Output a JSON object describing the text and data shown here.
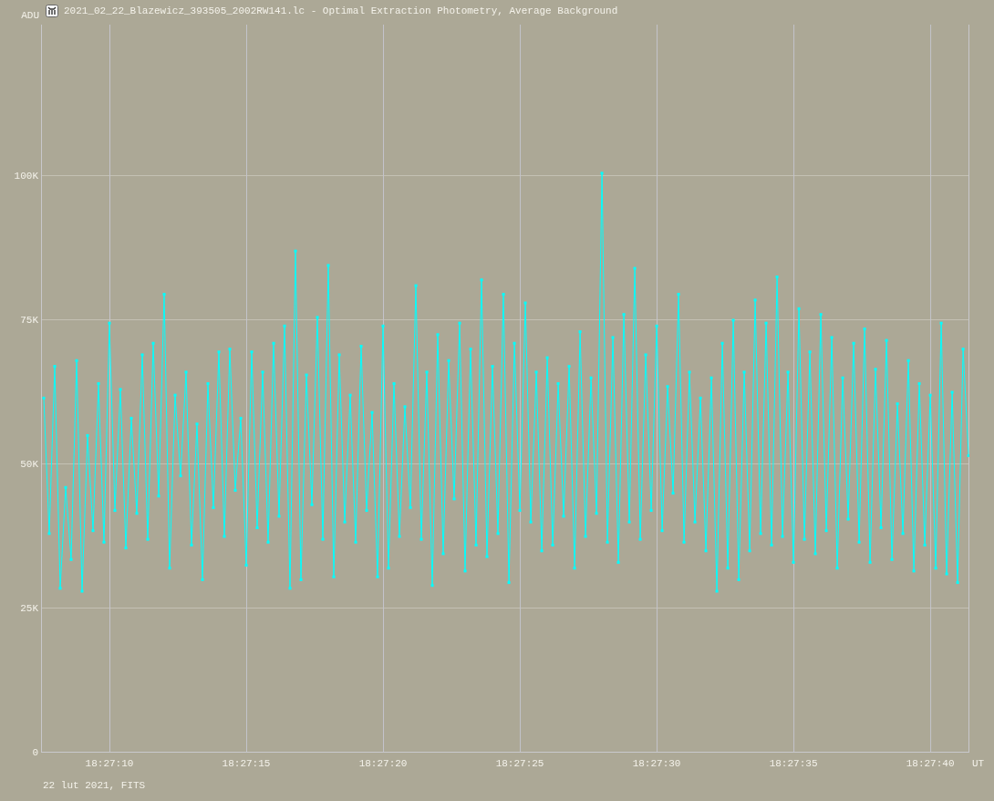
{
  "window": {
    "title": "2021_02_22_Blazewicz_393505_2002RW141.lc - Optimal Extraction Photometry, Average Background"
  },
  "chart_data": {
    "type": "line",
    "ylabel": "ADU",
    "xlabel": "UT",
    "grid": true,
    "xlim": [
      66427.5,
      66461.43
    ],
    "ylim": [
      0,
      126266
    ],
    "xticks": [
      {
        "value": 66430,
        "label": "18:27:10"
      },
      {
        "value": 66435,
        "label": "18:27:15"
      },
      {
        "value": 66440,
        "label": "18:27:20"
      },
      {
        "value": 66445,
        "label": "18:27:25"
      },
      {
        "value": 66450,
        "label": "18:27:30"
      },
      {
        "value": 66455,
        "label": "18:27:35"
      },
      {
        "value": 66460,
        "label": "18:27:40"
      }
    ],
    "yticks": [
      {
        "value": 100000,
        "label": "100K"
      },
      {
        "value": 75000,
        "label": "75K"
      },
      {
        "value": 50000,
        "label": "50K"
      },
      {
        "value": 25000,
        "label": "25K"
      },
      {
        "value": 0,
        "label": "0"
      }
    ],
    "x": [
      66427.6,
      66427.8,
      66428.0,
      66428.2,
      66428.4,
      66428.6,
      66428.8,
      66429.0,
      66429.2,
      66429.4,
      66429.6,
      66429.8,
      66430.0,
      66430.2,
      66430.4,
      66430.6,
      66430.8,
      66431.0,
      66431.2,
      66431.4,
      66431.6,
      66431.8,
      66432.0,
      66432.2,
      66432.4,
      66432.6,
      66432.8,
      66433.0,
      66433.2,
      66433.4,
      66433.6,
      66433.8,
      66434.0,
      66434.2,
      66434.4,
      66434.6,
      66434.8,
      66435.0,
      66435.2,
      66435.4,
      66435.6,
      66435.8,
      66436.0,
      66436.2,
      66436.4,
      66436.6,
      66436.8,
      66437.0,
      66437.2,
      66437.4,
      66437.6,
      66437.8,
      66438.0,
      66438.2,
      66438.4,
      66438.6,
      66438.8,
      66439.0,
      66439.2,
      66439.4,
      66439.6,
      66439.8,
      66440.0,
      66440.2,
      66440.4,
      66440.6,
      66440.8,
      66441.0,
      66441.2,
      66441.4,
      66441.6,
      66441.8,
      66442.0,
      66442.2,
      66442.4,
      66442.6,
      66442.8,
      66443.0,
      66443.2,
      66443.4,
      66443.6,
      66443.8,
      66444.0,
      66444.2,
      66444.4,
      66444.6,
      66444.8,
      66445.0,
      66445.2,
      66445.4,
      66445.6,
      66445.8,
      66446.0,
      66446.2,
      66446.4,
      66446.6,
      66446.8,
      66447.0,
      66447.2,
      66447.4,
      66447.6,
      66447.8,
      66448.0,
      66448.2,
      66448.4,
      66448.6,
      66448.8,
      66449.0,
      66449.2,
      66449.4,
      66449.6,
      66449.8,
      66450.0,
      66450.2,
      66450.4,
      66450.6,
      66450.8,
      66451.0,
      66451.2,
      66451.4,
      66451.6,
      66451.8,
      66452.0,
      66452.2,
      66452.4,
      66452.6,
      66452.8,
      66453.0,
      66453.2,
      66453.4,
      66453.6,
      66453.8,
      66454.0,
      66454.2,
      66454.4,
      66454.6,
      66454.8,
      66455.0,
      66455.2,
      66455.4,
      66455.6,
      66455.8,
      66456.0,
      66456.2,
      66456.4,
      66456.6,
      66456.8,
      66457.0,
      66457.2,
      66457.4,
      66457.6,
      66457.8,
      66458.0,
      66458.2,
      66458.4,
      66458.6,
      66458.8,
      66459.0,
      66459.2,
      66459.4,
      66459.6,
      66459.8,
      66460.0,
      66460.2,
      66460.4,
      66460.6,
      66460.8,
      66461.0,
      66461.2,
      66461.4
    ],
    "series": [
      {
        "color": "#00ffff",
        "marker": "square",
        "values": [
          61500,
          38000,
          67000,
          28500,
          46000,
          33500,
          68000,
          28000,
          55000,
          38500,
          64000,
          36500,
          74500,
          42000,
          63000,
          35500,
          58000,
          41500,
          69000,
          37000,
          71000,
          44500,
          79500,
          32000,
          62000,
          48000,
          66000,
          36000,
          57000,
          30000,
          64000,
          42500,
          69500,
          37500,
          70000,
          45500,
          58000,
          32500,
          69500,
          39000,
          66000,
          36500,
          71000,
          41000,
          74000,
          28500,
          87000,
          30000,
          65500,
          43000,
          75500,
          37000,
          84500,
          30500,
          69000,
          40000,
          62000,
          36500,
          70500,
          42000,
          59000,
          30500,
          74000,
          32000,
          64000,
          37500,
          60000,
          42500,
          81000,
          37000,
          66000,
          29000,
          72500,
          34500,
          68000,
          44000,
          74500,
          31500,
          70000,
          36000,
          82000,
          34000,
          67000,
          38000,
          79500,
          29500,
          71000,
          42000,
          78000,
          40000,
          66000,
          35000,
          68500,
          36000,
          64000,
          41000,
          67000,
          32000,
          73000,
          37500,
          65000,
          41500,
          100500,
          36500,
          72000,
          33000,
          76000,
          40000,
          84000,
          37000,
          69000,
          42000,
          74000,
          38500,
          63500,
          45000,
          79500,
          36500,
          66000,
          40000,
          61500,
          35000,
          65000,
          28000,
          71000,
          32000,
          75000,
          30000,
          66000,
          35000,
          78500,
          38000,
          74500,
          36000,
          82500,
          37500,
          66000,
          33000,
          77000,
          37000,
          69500,
          34500,
          76000,
          38500,
          72000,
          32000,
          65000,
          40500,
          71000,
          36500,
          73500,
          33000,
          66500,
          39000,
          71500,
          33500,
          60500,
          38000,
          68000,
          31500,
          64000,
          36000,
          62000,
          32000,
          74500,
          31000,
          62500,
          29500,
          70000,
          51500
        ]
      }
    ]
  },
  "footer": "22 lut 2021, FITS"
}
